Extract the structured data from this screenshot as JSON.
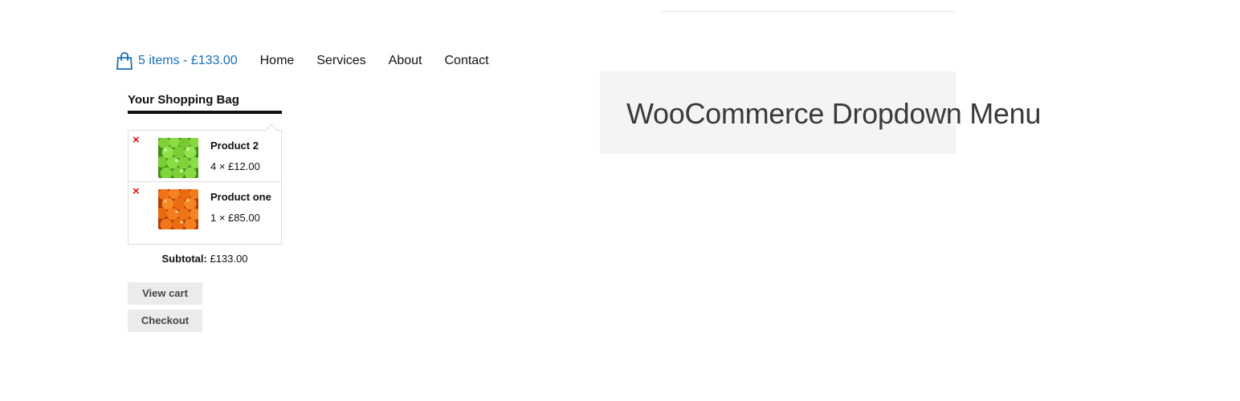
{
  "header": {
    "cart_summary": "5 items - £133.00",
    "nav": [
      {
        "label": "Home"
      },
      {
        "label": "Services"
      },
      {
        "label": "About"
      },
      {
        "label": "Contact"
      }
    ]
  },
  "cart_dropdown": {
    "title": "Your Shopping Bag",
    "items": [
      {
        "name": "Product 2",
        "quantity_price": "4 × £12.00",
        "remove_icon": "×",
        "thumbnail": "green-apples"
      },
      {
        "name": "Product one",
        "quantity_price": "1 × £85.00",
        "remove_icon": "×",
        "thumbnail": "oranges"
      }
    ],
    "subtotal_label": "Subtotal:",
    "subtotal_value": "£133.00",
    "view_cart_label": "View cart",
    "checkout_label": "Checkout"
  },
  "hero": {
    "title": "WooCommerce Dropdown Menu"
  },
  "colors": {
    "link": "#1a6fb8",
    "remove": "#e01010",
    "button_bg": "#ebebeb",
    "hero_bg": "#f4f4f4"
  }
}
